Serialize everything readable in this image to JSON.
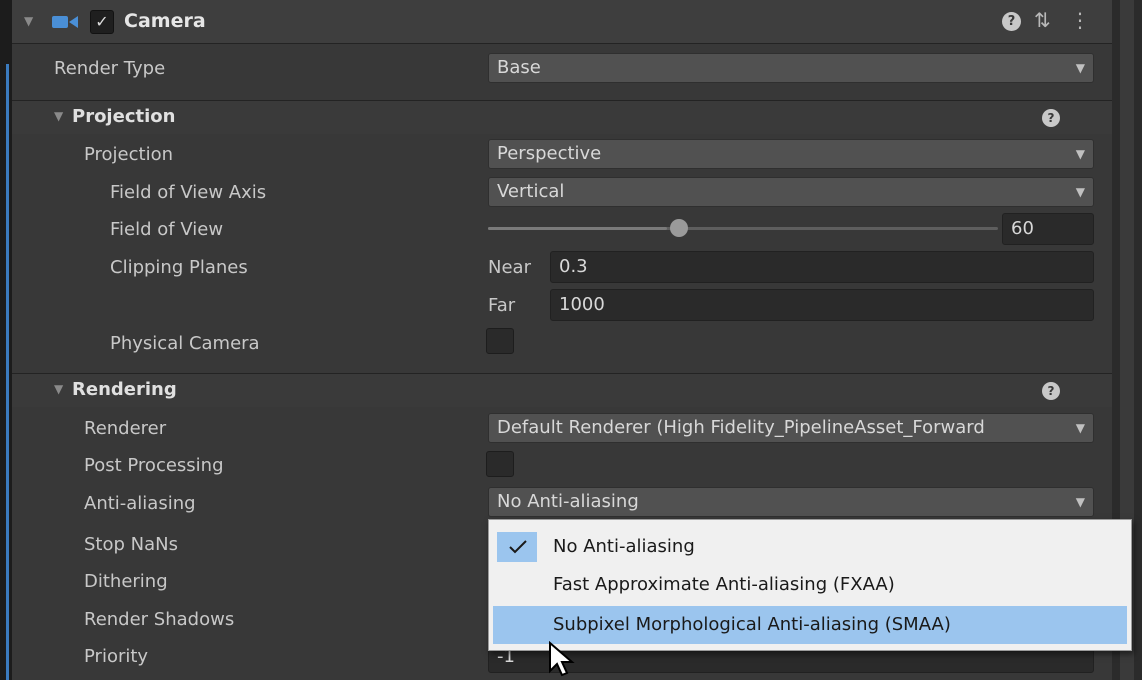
{
  "component": {
    "title": "Camera",
    "enabled": true,
    "icons": [
      "camera-icon",
      "help-icon",
      "preset-icon",
      "more-menu-icon"
    ]
  },
  "render_type": {
    "label": "Render Type",
    "value": "Base"
  },
  "projection": {
    "title": "Projection",
    "projection_label": "Projection",
    "projection_value": "Perspective",
    "fov_axis_label": "Field of View Axis",
    "fov_axis_value": "Vertical",
    "fov_label": "Field of View",
    "fov_value": "60",
    "fov_slider_fraction": 0.35,
    "clipping_label": "Clipping Planes",
    "near_label": "Near",
    "near_value": "0.3",
    "far_label": "Far",
    "far_value": "1000",
    "physical_label": "Physical Camera",
    "physical_checked": false
  },
  "rendering": {
    "title": "Rendering",
    "renderer_label": "Renderer",
    "renderer_value": "Default Renderer (High Fidelity_PipelineAsset_Forward",
    "post_label": "Post Processing",
    "post_checked": false,
    "aa_label": "Anti-aliasing",
    "aa_value": "No Anti-aliasing",
    "stop_nans_label": "Stop NaNs",
    "dithering_label": "Dithering",
    "shadows_label": "Render Shadows",
    "priority_label": "Priority",
    "priority_value": "-1"
  },
  "aa_popup": {
    "options": [
      "No Anti-aliasing",
      "Fast Approximate Anti-aliasing (FXAA)",
      "Subpixel Morphological Anti-aliasing (SMAA)"
    ],
    "selected_index": 0,
    "hover_index": 2
  },
  "colors": {
    "panel_bg": "#383838",
    "accent_blue": "#3b7bbf",
    "popup_highlight": "#9bc5ee"
  }
}
